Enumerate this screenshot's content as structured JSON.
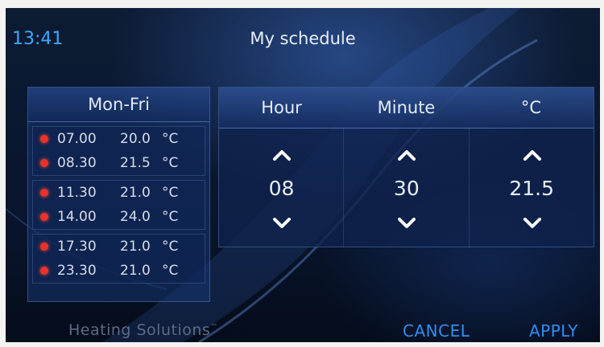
{
  "header": {
    "time": "13:41",
    "title": "My schedule"
  },
  "schedule": {
    "period": "Mon-Fri",
    "groups": [
      [
        {
          "time": "07.00",
          "temp": "20.0",
          "unit": "°C"
        },
        {
          "time": "08.30",
          "temp": "21.5",
          "unit": "°C"
        }
      ],
      [
        {
          "time": "11.30",
          "temp": "21.0",
          "unit": "°C"
        },
        {
          "time": "14.00",
          "temp": "24.0",
          "unit": "°C"
        }
      ],
      [
        {
          "time": "17.30",
          "temp": "21.0",
          "unit": "°C"
        },
        {
          "time": "23.30",
          "temp": "21.0",
          "unit": "°C"
        }
      ]
    ]
  },
  "editor": {
    "columns": [
      {
        "label": "Hour",
        "value": "08"
      },
      {
        "label": "Minute",
        "value": "30"
      },
      {
        "label": "°C",
        "value": "21.5"
      }
    ]
  },
  "footer": {
    "brand": "Heating Solutions",
    "trademark": "™",
    "cancel": "CANCEL",
    "apply": "APPLY"
  },
  "colors": {
    "accent": "#2f8ef0",
    "time": "#3aa8ff",
    "marker": "#e8322a",
    "background": "#0a1730"
  },
  "icons": {
    "up": "chevron-up-icon",
    "down": "chevron-down-icon",
    "marker": "red-dot-icon"
  }
}
